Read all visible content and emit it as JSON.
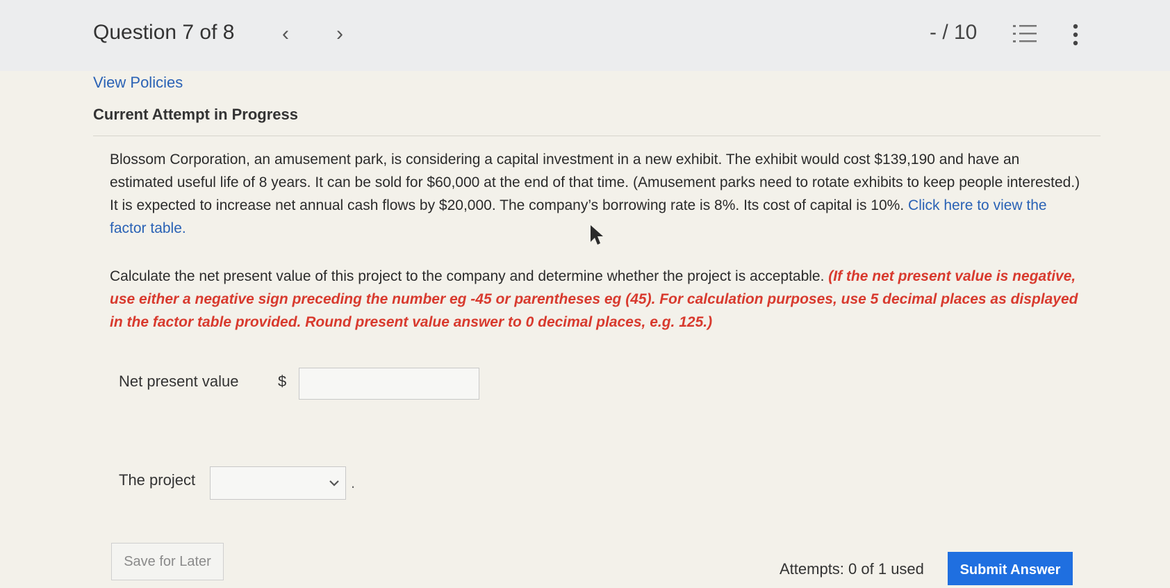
{
  "header": {
    "question_label": "Question 7 of 8",
    "prev_icon": "chevron-left-icon",
    "next_icon": "chevron-right-icon",
    "score": "- / 10",
    "list_icon": "question-list-icon",
    "more_icon": "more-vertical-icon"
  },
  "policies_link": "View Policies",
  "attempt_heading": "Current Attempt in Progress",
  "problem": {
    "text": "Blossom Corporation, an amusement park, is considering a capital investment in a new exhibit. The exhibit would cost $139,190 and have an estimated useful life of 8 years. It can be sold for $60,000 at the end of that time. (Amusement parks need to rotate exhibits to keep people interested.) It is expected to increase net annual cash flows by $20,000. The company’s borrowing rate is 8%. Its cost of capital is 10%.",
    "link_text": "Click here to view the factor table."
  },
  "instruction": {
    "text": "Calculate the net present value of this project to the company and determine whether the project is acceptable.",
    "red_text": "(If the net present value is negative, use either a negative sign preceding the number eg -45 or parentheses eg (45). For calculation purposes, use 5 decimal places as displayed in the factor table provided. Round present value answer to 0 decimal places, e.g. 125.)"
  },
  "npv": {
    "label": "Net present value",
    "currency": "$",
    "value": ""
  },
  "project": {
    "label": "The project",
    "selected": "",
    "period": "."
  },
  "footer": {
    "save_label": "Save for Later",
    "attempts_text": "Attempts: 0 of 1 used",
    "submit_label": "Submit Answer"
  },
  "colors": {
    "link": "#2a62b5",
    "warning": "#d83a2e",
    "submit": "#1f6fe0"
  }
}
